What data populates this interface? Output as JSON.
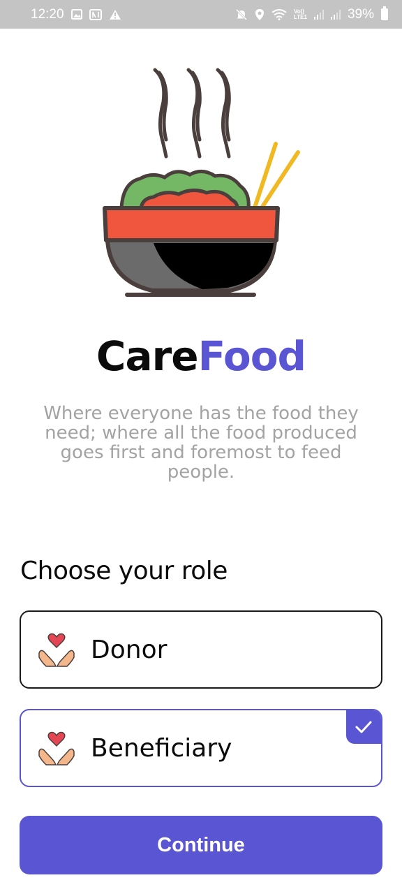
{
  "status_bar": {
    "time": "12:20",
    "battery": "39%",
    "icons": [
      "image-icon",
      "nfc-icon",
      "alert-icon",
      "mute-icon",
      "location-icon",
      "wifi-icon",
      "volte-icon",
      "signal-icon",
      "signal-icon",
      "battery-icon"
    ],
    "volte_top": "Vo))",
    "volte_bottom": "LTE1"
  },
  "hero": {
    "icon": "food-bowl-icon"
  },
  "brand": {
    "part1": "Care",
    "part2": "Food"
  },
  "tagline": "Where everyone has the food they need; where all the food produced goes first and foremost to feed people.",
  "roles": {
    "title": "Choose your role",
    "items": [
      {
        "label": "Donor",
        "icon": "heart-hands-icon",
        "selected": false
      },
      {
        "label": "Beneficiary",
        "icon": "heart-hands-icon",
        "selected": true
      }
    ]
  },
  "continue_label": "Continue",
  "colors": {
    "accent": "#5a55d2",
    "status_bar_bg": "#c4c4c4",
    "tagline": "#a3a3a3",
    "bowl_red": "#f0553e",
    "bowl_green": "#74b866",
    "chopsticks": "#f0b923",
    "outline": "#4a3f3d"
  }
}
